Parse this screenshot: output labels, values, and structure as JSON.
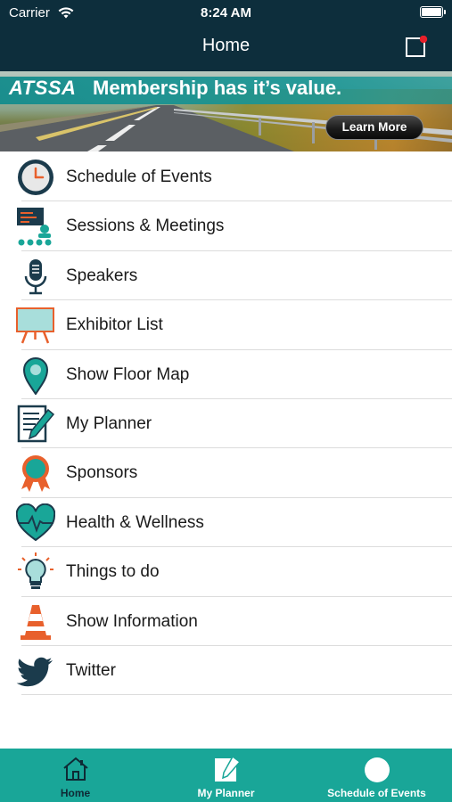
{
  "status_bar": {
    "carrier": "Carrier",
    "time": "8:24 AM"
  },
  "header": {
    "title": "Home",
    "notification_dot_color": "#e8202a"
  },
  "banner": {
    "brand": "ATSSA",
    "tagline": "Membership has it’s value.",
    "cta_label": "Learn More"
  },
  "menu": {
    "items": [
      {
        "label": "Schedule of Events",
        "icon": "clock-icon"
      },
      {
        "label": "Sessions & Meetings",
        "icon": "presentation-icon"
      },
      {
        "label": "Speakers",
        "icon": "microphone-icon"
      },
      {
        "label": "Exhibitor List",
        "icon": "easel-board-icon"
      },
      {
        "label": "Show Floor Map",
        "icon": "map-pin-icon"
      },
      {
        "label": "My Planner",
        "icon": "notepad-pencil-icon"
      },
      {
        "label": "Sponsors",
        "icon": "award-ribbon-icon"
      },
      {
        "label": "Health & Wellness",
        "icon": "heart-pulse-icon"
      },
      {
        "label": "Things to do",
        "icon": "lightbulb-icon"
      },
      {
        "label": "Show Information",
        "icon": "traffic-cone-icon"
      },
      {
        "label": "Twitter",
        "icon": "twitter-bird-icon"
      }
    ]
  },
  "tabbar": {
    "tabs": [
      {
        "label": "Home",
        "icon": "home-icon",
        "active": true
      },
      {
        "label": "My Planner",
        "icon": "planner-icon",
        "active": false
      },
      {
        "label": "Schedule of Events",
        "icon": "circle-icon",
        "active": false
      }
    ]
  },
  "colors": {
    "header_bg": "#0d2e3c",
    "accent_teal": "#19a698",
    "icon_navy": "#1b3b4c",
    "icon_orange": "#e8602c"
  }
}
